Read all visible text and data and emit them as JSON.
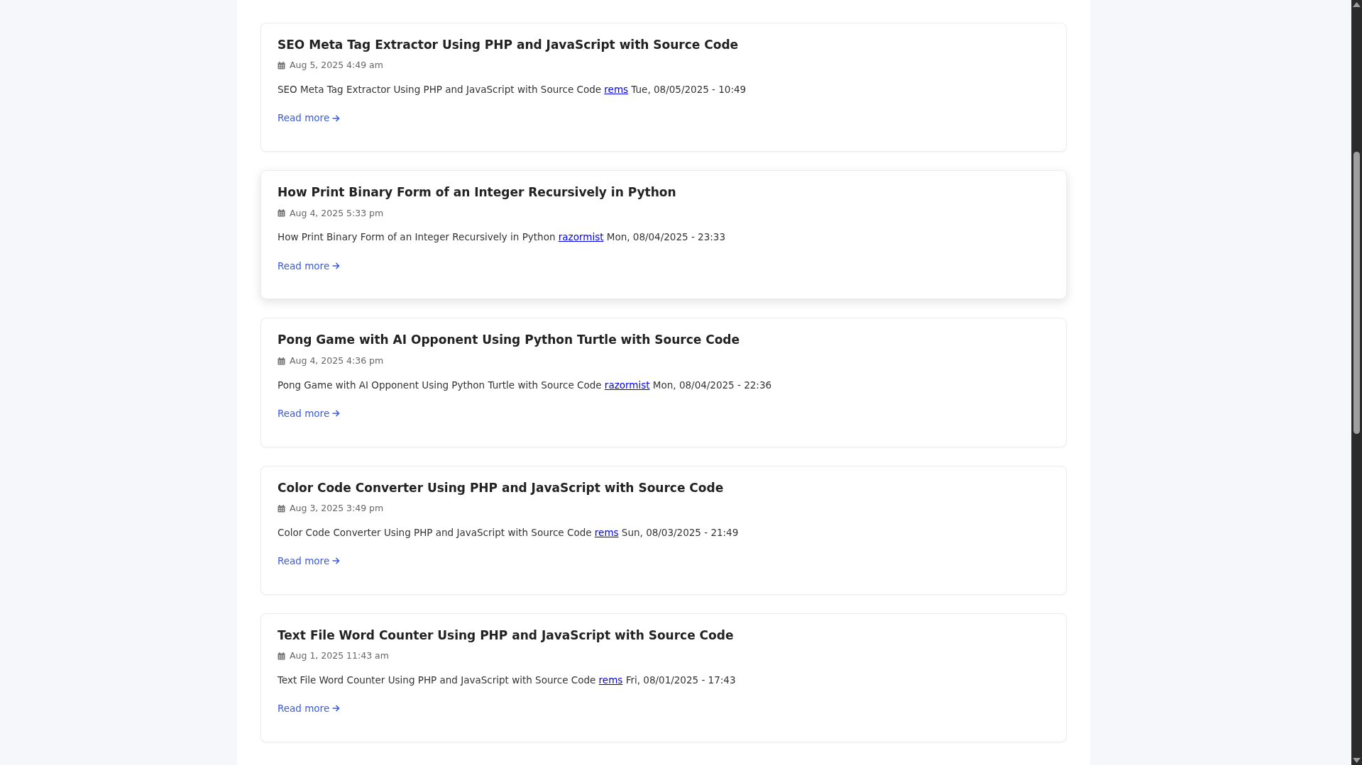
{
  "posts": [
    {
      "title": "SEO Meta Tag Extractor Using PHP and JavaScript with Source Code",
      "date": "Aug 5, 2025 4:49 am",
      "excerpt": "SEO Meta Tag Extractor Using PHP and JavaScript with Source Code",
      "author": "rems",
      "timestamp": "Tue, 08/05/2025 - 10:49",
      "read_more": "Read more",
      "hovered": false
    },
    {
      "title": "How Print Binary Form of an Integer Recursively in Python",
      "date": "Aug 4, 2025 5:33 pm",
      "excerpt": "How Print Binary Form of an Integer Recursively in Python",
      "author": "razormist",
      "timestamp": "Mon, 08/04/2025 - 23:33",
      "read_more": "Read more",
      "hovered": true
    },
    {
      "title": "Pong Game with AI Opponent Using Python Turtle with Source Code",
      "date": "Aug 4, 2025 4:36 pm",
      "excerpt": "Pong Game with AI Opponent Using Python Turtle with Source Code",
      "author": "razormist",
      "timestamp": "Mon, 08/04/2025 - 22:36",
      "read_more": "Read more",
      "hovered": false
    },
    {
      "title": "Color Code Converter Using PHP and JavaScript with Source Code",
      "date": "Aug 3, 2025 3:49 pm",
      "excerpt": "Color Code Converter Using PHP and JavaScript with Source Code",
      "author": "rems",
      "timestamp": "Sun, 08/03/2025 - 21:49",
      "read_more": "Read more",
      "hovered": false
    },
    {
      "title": "Text File Word Counter Using PHP and JavaScript with Source Code",
      "date": "Aug 1, 2025 11:43 am",
      "excerpt": "Text File Word Counter Using PHP and JavaScript with Source Code",
      "author": "rems",
      "timestamp": "Fri, 08/01/2025 - 17:43",
      "read_more": "Read more",
      "hovered": false
    }
  ]
}
